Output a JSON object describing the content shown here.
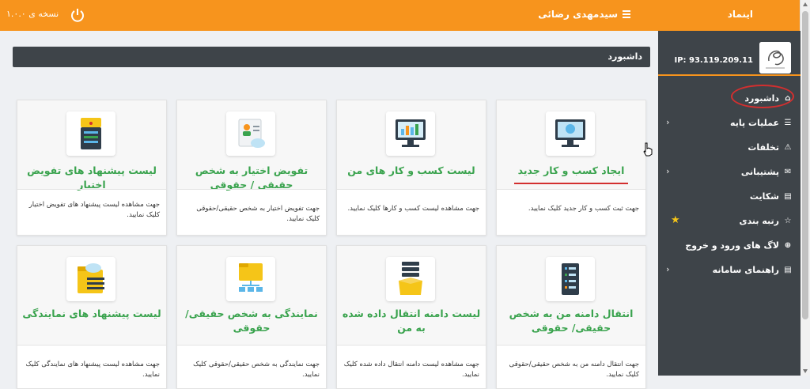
{
  "topbar": {
    "brand": "اینماد",
    "user_name": "سیدمهدی رضائی",
    "version": "نسخه ی ۱.۰.۰"
  },
  "sidebar": {
    "ip": "IP: 93.119.209.11",
    "items": [
      {
        "label": "داشبورد",
        "icon": "home-icon"
      },
      {
        "label": "عملیات پایه",
        "icon": "list-icon"
      },
      {
        "label": "تخلفات",
        "icon": "warning-icon"
      },
      {
        "label": "پشتیبانی",
        "icon": "chat-icon"
      },
      {
        "label": "شکایت",
        "icon": "file-icon"
      },
      {
        "label": "رتبه بندی",
        "icon": "star-icon"
      },
      {
        "label": "لاگ های ورود و خروج",
        "icon": "plus-circle-icon"
      },
      {
        "label": "راهنمای سامانه",
        "icon": "doc-icon"
      }
    ]
  },
  "page": {
    "title": "داشبورد"
  },
  "cards": [
    {
      "title": "ایجاد کسب و کار جدید",
      "desc": "جهت ثبت کسب و کار جدید کلیک نمایید."
    },
    {
      "title": "لیست کسب و کار های من",
      "desc": "جهت مشاهده لیست کسب و کارها کلیک نمایید."
    },
    {
      "title": "تفویض اختیار به شخص حقیقی / حقوقی",
      "desc": "جهت تفویض اختیار به شخص حقیقی/حقوقی کلیک نمایید."
    },
    {
      "title": "لیست پیشنهاد های تفویض اختیار",
      "desc": "جهت مشاهده لیست پیشنهاد های تفویض اختیار کلیک نمایید."
    },
    {
      "title": "انتقال دامنه من به شخص حقیقی/ حقوقی",
      "desc": "جهت انتقال دامنه من به شخص حقیقی/حقوقی کلیک نمایید."
    },
    {
      "title": "لیست دامنه انتقال داده شده به من",
      "desc": "جهت مشاهده لیست دامنه انتقال داده شده کلیک نمایید."
    },
    {
      "title": "نمایندگی به شخص حقیقی/حقوقی",
      "desc": "جهت نمایندگی به شخص حقیقی/حقوقی کلیک نمایید."
    },
    {
      "title": "لیست پیشنهاد های نمایندگی",
      "desc": "جهت مشاهده لیست پیشنهاد های نمایندگی کلیک نمایید."
    }
  ],
  "colors": {
    "accent": "#f7941d",
    "sidebar": "#3e4449",
    "title_green": "#3aa34e",
    "annotation_red": "#d32f2f"
  }
}
